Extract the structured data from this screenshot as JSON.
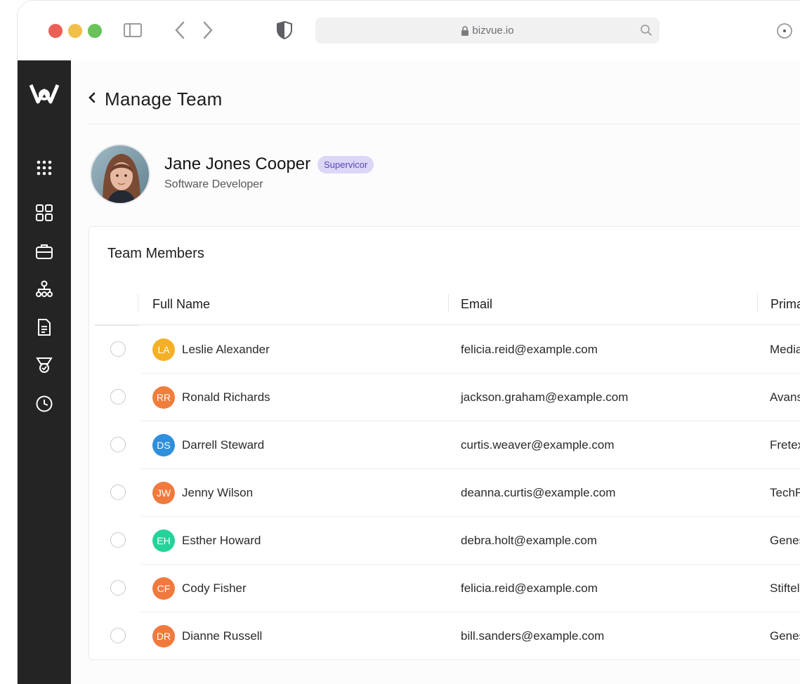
{
  "browser": {
    "url": "bizvue.io"
  },
  "sidebar": {
    "items": [
      {
        "icon": "logo-icon"
      },
      {
        "icon": "apps-grid-icon"
      },
      {
        "icon": "dashboard-icon"
      },
      {
        "icon": "briefcase-icon"
      },
      {
        "icon": "org-chart-icon"
      },
      {
        "icon": "document-icon"
      },
      {
        "icon": "award-icon"
      },
      {
        "icon": "clock-icon"
      }
    ]
  },
  "header": {
    "title": "Manage Team"
  },
  "profile": {
    "name": "Jane Jones Cooper",
    "badge": "Supervicor",
    "job_title": "Software Developer"
  },
  "team": {
    "title": "Team Members",
    "columns": {
      "full_name": "Full Name",
      "email": "Email",
      "company": "Prima"
    },
    "rows": [
      {
        "initials": "LA",
        "name": "Leslie Alexander",
        "email": "felicia.reid@example.com",
        "company": "Media",
        "color": "#f5b025"
      },
      {
        "initials": "RR",
        "name": "Ronald Richards",
        "email": "jackson.graham@example.com",
        "company": "Avans",
        "color": "#f07d3a"
      },
      {
        "initials": "DS",
        "name": "Darrell Steward",
        "email": "curtis.weaver@example.com",
        "company": "Fretex",
        "color": "#2e8fdc"
      },
      {
        "initials": "JW",
        "name": "Jenny Wilson",
        "email": "deanna.curtis@example.com",
        "company": "TechF",
        "color": "#f07a3d"
      },
      {
        "initials": "EH",
        "name": "Esther Howard",
        "email": "debra.holt@example.com",
        "company": "Genes",
        "color": "#24d39a"
      },
      {
        "initials": "CF",
        "name": "Cody Fisher",
        "email": "felicia.reid@example.com",
        "company": "Stiftel",
        "color": "#f07a3d"
      },
      {
        "initials": "DR",
        "name": "Dianne Russell",
        "email": "bill.sanders@example.com",
        "company": "Genes",
        "color": "#f07a3d"
      }
    ]
  }
}
